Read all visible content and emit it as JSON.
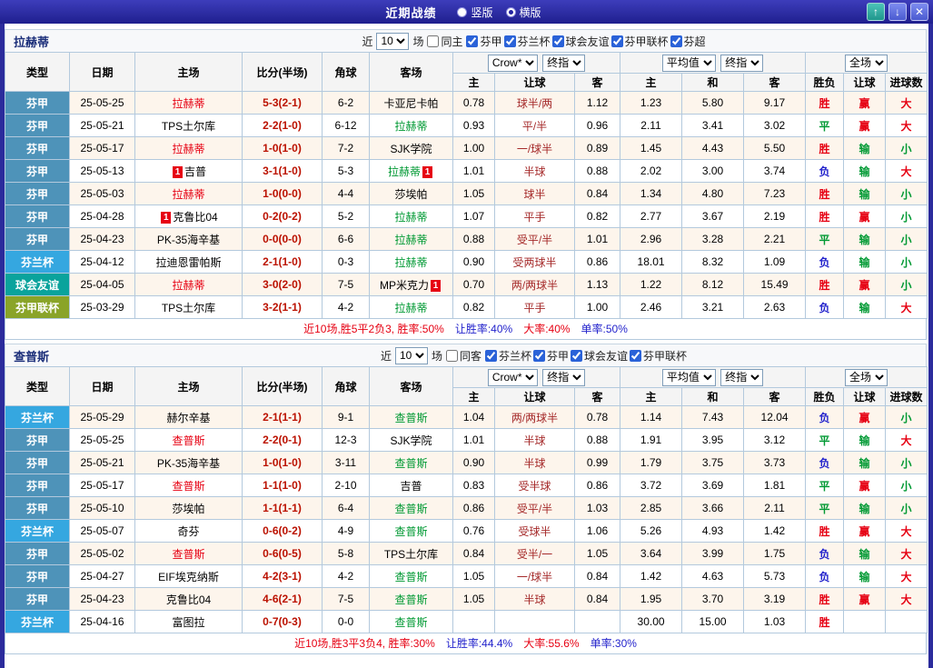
{
  "topbar": {
    "title": "近期战绩",
    "vertical_label": "竖版",
    "horizontal_label": "横版",
    "selected": "横版",
    "up_button": "↑",
    "down_button": "↓",
    "close_button": "✕"
  },
  "controls": {
    "near": "近",
    "near_count": "10",
    "games": "场",
    "bookmaker": "Crow*",
    "bookmaker_final": "终指",
    "average": "平均值",
    "average_final": "终指",
    "full_match": "全场"
  },
  "table_headers": {
    "type": "类型",
    "date": "日期",
    "home": "主场",
    "score": "比分(半场)",
    "corners": "角球",
    "away": "客场",
    "odds_home": "主",
    "odds_handicap": "让球",
    "odds_away": "客",
    "avg_home": "主",
    "avg_draw": "和",
    "avg_away": "客",
    "result": "胜负",
    "handicap_result": "让球",
    "goals": "进球数"
  },
  "colors": {
    "red": "#e60012",
    "green": "#009933",
    "blue": "#2323cc",
    "score": "#bb1100",
    "line": "#a52a2a",
    "badge": "#e60012",
    "type_colors": {
      "芬甲": "#4e93b9",
      "芬兰杯": "#35a7e0",
      "球会友谊": "#0aa39c",
      "芬甲联杯": "#8aa428"
    },
    "value_colors": {
      "胜": "red",
      "平": "green",
      "负": "blue",
      "赢": "red",
      "输": "green",
      "走": "blue",
      "大": "red",
      "小": "green"
    }
  },
  "sections": [
    {
      "team": "拉赫蒂",
      "same_label": "同主",
      "same_checked": false,
      "filters": [
        {
          "label": "芬甲",
          "checked": true
        },
        {
          "label": "芬兰杯",
          "checked": true
        },
        {
          "label": "球会友谊",
          "checked": true
        },
        {
          "label": "芬甲联杯",
          "checked": true
        },
        {
          "label": "芬超",
          "checked": true
        }
      ],
      "rows": [
        {
          "type": "芬甲",
          "date": "25-05-25",
          "home": "拉赫蒂",
          "home_focal": true,
          "home_badge": "",
          "score": "5-3(2-1)",
          "corners": "6-2",
          "away": "卡亚尼卡帕",
          "away_focal": false,
          "away_badge": "",
          "ah": [
            "0.78",
            "球半/两",
            "1.12"
          ],
          "avg": [
            "1.23",
            "5.80",
            "9.17"
          ],
          "result": "胜",
          "handicap": "赢",
          "goals": "大"
        },
        {
          "type": "芬甲",
          "date": "25-05-21",
          "home": "TPS土尔库",
          "home_focal": false,
          "home_badge": "",
          "score": "2-2(1-0)",
          "corners": "6-12",
          "away": "拉赫蒂",
          "away_focal": true,
          "away_badge": "",
          "ah": [
            "0.93",
            "平/半",
            "0.96"
          ],
          "avg": [
            "2.11",
            "3.41",
            "3.02"
          ],
          "result": "平",
          "handicap": "赢",
          "goals": "大"
        },
        {
          "type": "芬甲",
          "date": "25-05-17",
          "home": "拉赫蒂",
          "home_focal": true,
          "home_badge": "",
          "score": "1-0(1-0)",
          "corners": "7-2",
          "away": "SJK学院",
          "away_focal": false,
          "away_badge": "",
          "ah": [
            "1.00",
            "一/球半",
            "0.89"
          ],
          "avg": [
            "1.45",
            "4.43",
            "5.50"
          ],
          "result": "胜",
          "handicap": "输",
          "goals": "小"
        },
        {
          "type": "芬甲",
          "date": "25-05-13",
          "home": "吉普",
          "home_focal": false,
          "home_badge": "1",
          "score": "3-1(1-0)",
          "corners": "5-3",
          "away": "拉赫蒂",
          "away_focal": true,
          "away_badge": "1",
          "ah": [
            "1.01",
            "半球",
            "0.88"
          ],
          "avg": [
            "2.02",
            "3.00",
            "3.74"
          ],
          "result": "负",
          "handicap": "输",
          "goals": "大"
        },
        {
          "type": "芬甲",
          "date": "25-05-03",
          "home": "拉赫蒂",
          "home_focal": true,
          "home_badge": "",
          "score": "1-0(0-0)",
          "corners": "4-4",
          "away": "莎埃帕",
          "away_focal": false,
          "away_badge": "",
          "ah": [
            "1.05",
            "球半",
            "0.84"
          ],
          "avg": [
            "1.34",
            "4.80",
            "7.23"
          ],
          "result": "胜",
          "handicap": "输",
          "goals": "小"
        },
        {
          "type": "芬甲",
          "date": "25-04-28",
          "home": "克鲁比04",
          "home_focal": false,
          "home_badge": "1",
          "score": "0-2(0-2)",
          "corners": "5-2",
          "away": "拉赫蒂",
          "away_focal": true,
          "away_badge": "",
          "ah": [
            "1.07",
            "平手",
            "0.82"
          ],
          "avg": [
            "2.77",
            "3.67",
            "2.19"
          ],
          "result": "胜",
          "handicap": "赢",
          "goals": "小"
        },
        {
          "type": "芬甲",
          "date": "25-04-23",
          "home": "PK-35海辛基",
          "home_focal": false,
          "home_badge": "",
          "score": "0-0(0-0)",
          "corners": "6-6",
          "away": "拉赫蒂",
          "away_focal": true,
          "away_badge": "",
          "ah": [
            "0.88",
            "受平/半",
            "1.01"
          ],
          "avg": [
            "2.96",
            "3.28",
            "2.21"
          ],
          "result": "平",
          "handicap": "输",
          "goals": "小"
        },
        {
          "type": "芬兰杯",
          "date": "25-04-12",
          "home": "拉迪恩雷帕斯",
          "home_focal": false,
          "home_badge": "",
          "score": "2-1(1-0)",
          "corners": "0-3",
          "away": "拉赫蒂",
          "away_focal": true,
          "away_badge": "",
          "ah": [
            "0.90",
            "受两球半",
            "0.86"
          ],
          "avg": [
            "18.01",
            "8.32",
            "1.09"
          ],
          "result": "负",
          "handicap": "输",
          "goals": "小"
        },
        {
          "type": "球会友谊",
          "date": "25-04-05",
          "home": "拉赫蒂",
          "home_focal": true,
          "home_badge": "",
          "score": "3-0(2-0)",
          "corners": "7-5",
          "away": "MP米克力",
          "away_focal": false,
          "away_badge": "1",
          "ah": [
            "0.70",
            "两/两球半",
            "1.13"
          ],
          "avg": [
            "1.22",
            "8.12",
            "15.49"
          ],
          "result": "胜",
          "handicap": "赢",
          "goals": "小"
        },
        {
          "type": "芬甲联杯",
          "date": "25-03-29",
          "home": "TPS土尔库",
          "home_focal": false,
          "home_badge": "",
          "score": "3-2(1-1)",
          "corners": "4-2",
          "away": "拉赫蒂",
          "away_focal": true,
          "away_badge": "",
          "ah": [
            "0.82",
            "平手",
            "1.00"
          ],
          "avg": [
            "2.46",
            "3.21",
            "2.63"
          ],
          "result": "负",
          "handicap": "输",
          "goals": "大"
        }
      ],
      "summary": [
        {
          "text": "近10场,胜5平2负3, 胜率:50%",
          "color": "red"
        },
        {
          "text": "让胜率:40%",
          "color": "blue"
        },
        {
          "text": "大率:40%",
          "color": "red"
        },
        {
          "text": "单率:50%",
          "color": "blue"
        }
      ]
    },
    {
      "team": "查普斯",
      "same_label": "同客",
      "same_checked": false,
      "filters": [
        {
          "label": "芬兰杯",
          "checked": true
        },
        {
          "label": "芬甲",
          "checked": true
        },
        {
          "label": "球会友谊",
          "checked": true
        },
        {
          "label": "芬甲联杯",
          "checked": true
        }
      ],
      "rows": [
        {
          "type": "芬兰杯",
          "date": "25-05-29",
          "home": "赫尔辛基",
          "home_focal": false,
          "home_badge": "",
          "score": "2-1(1-1)",
          "corners": "9-1",
          "away": "查普斯",
          "away_focal": true,
          "away_badge": "",
          "ah": [
            "1.04",
            "两/两球半",
            "0.78"
          ],
          "avg": [
            "1.14",
            "7.43",
            "12.04"
          ],
          "result": "负",
          "handicap": "赢",
          "goals": "小"
        },
        {
          "type": "芬甲",
          "date": "25-05-25",
          "home": "查普斯",
          "home_focal": true,
          "home_badge": "",
          "score": "2-2(0-1)",
          "corners": "12-3",
          "away": "SJK学院",
          "away_focal": false,
          "away_badge": "",
          "ah": [
            "1.01",
            "半球",
            "0.88"
          ],
          "avg": [
            "1.91",
            "3.95",
            "3.12"
          ],
          "result": "平",
          "handicap": "输",
          "goals": "大"
        },
        {
          "type": "芬甲",
          "date": "25-05-21",
          "home": "PK-35海辛基",
          "home_focal": false,
          "home_badge": "",
          "score": "1-0(1-0)",
          "corners": "3-11",
          "away": "查普斯",
          "away_focal": true,
          "away_badge": "",
          "ah": [
            "0.90",
            "半球",
            "0.99"
          ],
          "avg": [
            "1.79",
            "3.75",
            "3.73"
          ],
          "result": "负",
          "handicap": "输",
          "goals": "小"
        },
        {
          "type": "芬甲",
          "date": "25-05-17",
          "home": "查普斯",
          "home_focal": true,
          "home_badge": "",
          "score": "1-1(1-0)",
          "corners": "2-10",
          "away": "吉普",
          "away_focal": false,
          "away_badge": "",
          "ah": [
            "0.83",
            "受半球",
            "0.86"
          ],
          "avg": [
            "3.72",
            "3.69",
            "1.81"
          ],
          "result": "平",
          "handicap": "赢",
          "goals": "小"
        },
        {
          "type": "芬甲",
          "date": "25-05-10",
          "home": "莎埃帕",
          "home_focal": false,
          "home_badge": "",
          "score": "1-1(1-1)",
          "corners": "6-4",
          "away": "查普斯",
          "away_focal": true,
          "away_badge": "",
          "ah": [
            "0.86",
            "受平/半",
            "1.03"
          ],
          "avg": [
            "2.85",
            "3.66",
            "2.11"
          ],
          "result": "平",
          "handicap": "输",
          "goals": "小"
        },
        {
          "type": "芬兰杯",
          "date": "25-05-07",
          "home": "奇芬",
          "home_focal": false,
          "home_badge": "",
          "score": "0-6(0-2)",
          "corners": "4-9",
          "away": "查普斯",
          "away_focal": true,
          "away_badge": "",
          "ah": [
            "0.76",
            "受球半",
            "1.06"
          ],
          "avg": [
            "5.26",
            "4.93",
            "1.42"
          ],
          "result": "胜",
          "handicap": "赢",
          "goals": "大"
        },
        {
          "type": "芬甲",
          "date": "25-05-02",
          "home": "查普斯",
          "home_focal": true,
          "home_badge": "",
          "score": "0-6(0-5)",
          "corners": "5-8",
          "away": "TPS土尔库",
          "away_focal": false,
          "away_badge": "",
          "ah": [
            "0.84",
            "受半/一",
            "1.05"
          ],
          "avg": [
            "3.64",
            "3.99",
            "1.75"
          ],
          "result": "负",
          "handicap": "输",
          "goals": "大"
        },
        {
          "type": "芬甲",
          "date": "25-04-27",
          "home": "EIF埃克纳斯",
          "home_focal": false,
          "home_badge": "",
          "score": "4-2(3-1)",
          "corners": "4-2",
          "away": "查普斯",
          "away_focal": true,
          "away_badge": "",
          "ah": [
            "1.05",
            "一/球半",
            "0.84"
          ],
          "avg": [
            "1.42",
            "4.63",
            "5.73"
          ],
          "result": "负",
          "handicap": "输",
          "goals": "大"
        },
        {
          "type": "芬甲",
          "date": "25-04-23",
          "home": "克鲁比04",
          "home_focal": false,
          "home_badge": "",
          "score": "4-6(2-1)",
          "corners": "7-5",
          "away": "查普斯",
          "away_focal": true,
          "away_badge": "",
          "ah": [
            "1.05",
            "半球",
            "0.84"
          ],
          "avg": [
            "1.95",
            "3.70",
            "3.19"
          ],
          "result": "胜",
          "handicap": "赢",
          "goals": "大"
        },
        {
          "type": "芬兰杯",
          "date": "25-04-16",
          "home": "富图拉",
          "home_focal": false,
          "home_badge": "",
          "score": "0-7(0-3)",
          "corners": "0-0",
          "away": "查普斯",
          "away_focal": true,
          "away_badge": "",
          "ah": [
            "",
            "",
            ""
          ],
          "avg": [
            "30.00",
            "15.00",
            "1.03"
          ],
          "result": "胜",
          "handicap": "",
          "goals": ""
        }
      ],
      "summary": [
        {
          "text": "近10场,胜3平3负4, 胜率:30%",
          "color": "red"
        },
        {
          "text": "让胜率:44.4%",
          "color": "blue"
        },
        {
          "text": "大率:55.6%",
          "color": "red"
        },
        {
          "text": "单率:30%",
          "color": "blue"
        }
      ]
    }
  ]
}
